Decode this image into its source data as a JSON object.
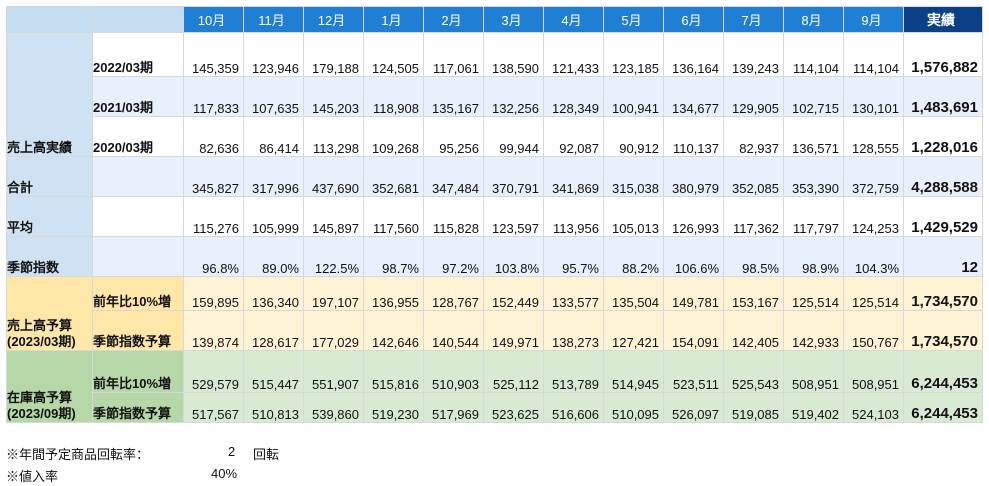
{
  "header": {
    "months": [
      "10月",
      "11月",
      "12月",
      "1月",
      "2月",
      "3月",
      "4月",
      "5月",
      "6月",
      "7月",
      "8月",
      "9月"
    ],
    "actual_label": "実績"
  },
  "sales_actual": {
    "group_label": "売上高実績",
    "rows": [
      {
        "label": "2022/03期",
        "values": [
          "145,359",
          "123,946",
          "179,188",
          "124,505",
          "117,061",
          "138,590",
          "121,433",
          "123,185",
          "136,164",
          "139,243",
          "114,104",
          "114,104"
        ],
        "total": "1,576,882"
      },
      {
        "label": "2021/03期",
        "values": [
          "117,833",
          "107,635",
          "145,203",
          "118,908",
          "135,167",
          "132,256",
          "128,349",
          "100,941",
          "134,677",
          "129,905",
          "102,715",
          "130,101"
        ],
        "total": "1,483,691"
      },
      {
        "label": "2020/03期",
        "values": [
          "82,636",
          "86,414",
          "113,298",
          "109,268",
          "95,256",
          "99,944",
          "92,087",
          "90,912",
          "110,137",
          "82,937",
          "136,571",
          "128,555"
        ],
        "total": "1,228,016"
      }
    ]
  },
  "summary": {
    "sum": {
      "label": "合計",
      "values": [
        "345,827",
        "317,996",
        "437,690",
        "352,681",
        "347,484",
        "370,791",
        "341,869",
        "315,038",
        "380,979",
        "352,085",
        "353,390",
        "372,759"
      ],
      "total": "4,288,588"
    },
    "avg": {
      "label": "平均",
      "values": [
        "115,276",
        "105,999",
        "145,897",
        "117,560",
        "115,828",
        "123,597",
        "113,956",
        "105,013",
        "126,993",
        "117,362",
        "117,797",
        "124,253"
      ],
      "total": "1,429,529"
    },
    "index": {
      "label": "季節指数",
      "values": [
        "96.8%",
        "89.0%",
        "122.5%",
        "98.7%",
        "97.2%",
        "103.8%",
        "95.7%",
        "88.2%",
        "106.6%",
        "98.5%",
        "98.9%",
        "104.3%"
      ],
      "total": "12"
    }
  },
  "sales_budget": {
    "group_label_1": "売上高予算",
    "group_label_2": "(2023/03期)",
    "rows": [
      {
        "label": "前年比10%増",
        "values": [
          "159,895",
          "136,340",
          "197,107",
          "136,955",
          "128,767",
          "152,449",
          "133,577",
          "135,504",
          "149,781",
          "153,167",
          "125,514",
          "125,514"
        ],
        "total": "1,734,570"
      },
      {
        "label": "季節指数予算",
        "values": [
          "139,874",
          "128,617",
          "177,029",
          "142,646",
          "140,544",
          "149,971",
          "138,273",
          "127,421",
          "154,091",
          "142,405",
          "142,933",
          "150,767"
        ],
        "total": "1,734,570"
      }
    ]
  },
  "stock_budget": {
    "group_label_1": "在庫高予算",
    "group_label_2": "(2023/09期)",
    "rows": [
      {
        "label": "前年比10%増",
        "values": [
          "529,579",
          "515,447",
          "551,907",
          "515,816",
          "510,903",
          "525,112",
          "513,789",
          "514,945",
          "523,511",
          "525,543",
          "508,951",
          "508,951"
        ],
        "total": "6,244,453"
      },
      {
        "label": "季節指数予算",
        "values": [
          "517,567",
          "510,813",
          "539,860",
          "519,230",
          "517,969",
          "523,625",
          "516,606",
          "510,095",
          "526,097",
          "519,085",
          "519,402",
          "524,103"
        ],
        "total": "6,244,453"
      }
    ]
  },
  "notes": {
    "turnover_label": "※年間予定商品回転率：",
    "turnover_value": "2",
    "turnover_unit": "回転",
    "cost_label": "※値入率",
    "cost_value": "40%"
  }
}
